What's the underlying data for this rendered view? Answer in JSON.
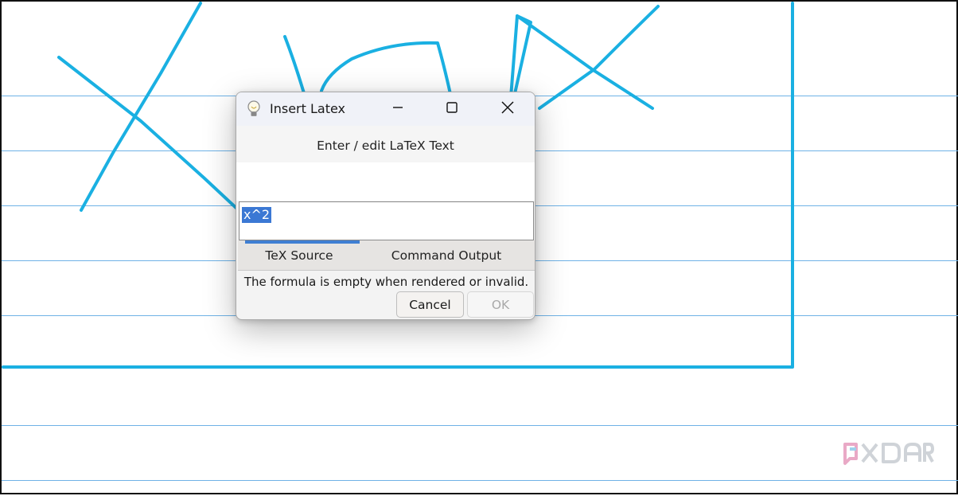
{
  "dialog": {
    "title": "Insert Latex",
    "title_icon": "lightbulb-icon",
    "window_controls": [
      "minimize-icon",
      "maximize-icon",
      "close-icon"
    ],
    "header": "Enter / edit LaTeX Text",
    "editor_value": "x^2",
    "tabs": [
      {
        "label": "TeX Source",
        "active": true
      },
      {
        "label": "Command Output",
        "active": false
      }
    ],
    "status": "The formula is empty when rendered or invalid.",
    "buttons": {
      "cancel": "Cancel",
      "ok": "OK",
      "ok_enabled": false
    }
  },
  "canvas": {
    "ink_color": "#1ab0e2",
    "ruled_line_color": "#6fb2e6",
    "handwriting_text": "XLaTeX"
  },
  "watermark": {
    "text": "XDA"
  },
  "colors": {
    "selection": "#3b78d4",
    "tab_indicator": "#3f7fd3"
  }
}
